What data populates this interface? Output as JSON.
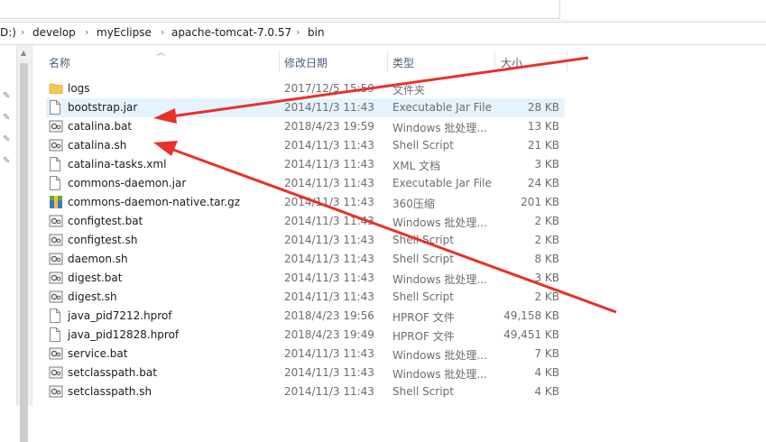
{
  "breadcrumb": [
    "D:)",
    "develop",
    "myEclipse",
    "apache-tomcat-7.0.57",
    "bin"
  ],
  "columns": {
    "name": "名称",
    "date": "修改日期",
    "type": "类型",
    "size": "大小"
  },
  "files": [
    {
      "name": "logs",
      "date": "2017/12/5 15:59",
      "type": "文件夹",
      "size": "",
      "icon": "folder-icon"
    },
    {
      "name": "bootstrap.jar",
      "date": "2014/11/3 11:43",
      "type": "Executable Jar File",
      "size": "28 KB",
      "icon": "file-icon"
    },
    {
      "name": "catalina.bat",
      "date": "2018/4/23 19:59",
      "type": "Windows 批处理...",
      "size": "13 KB",
      "icon": "script-gear-icon"
    },
    {
      "name": "catalina.sh",
      "date": "2014/11/3 11:43",
      "type": "Shell Script",
      "size": "21 KB",
      "icon": "script-gear-icon"
    },
    {
      "name": "catalina-tasks.xml",
      "date": "2014/11/3 11:43",
      "type": "XML 文档",
      "size": "3 KB",
      "icon": "file-icon"
    },
    {
      "name": "commons-daemon.jar",
      "date": "2014/11/3 11:43",
      "type": "Executable Jar File",
      "size": "24 KB",
      "icon": "file-icon"
    },
    {
      "name": "commons-daemon-native.tar.gz",
      "date": "2014/11/3 11:43",
      "type": "360压缩",
      "size": "201 KB",
      "icon": "archive-icon"
    },
    {
      "name": "configtest.bat",
      "date": "2014/11/3 11:43",
      "type": "Windows 批处理...",
      "size": "2 KB",
      "icon": "script-gear-icon"
    },
    {
      "name": "configtest.sh",
      "date": "2014/11/3 11:43",
      "type": "Shell Script",
      "size": "2 KB",
      "icon": "script-gear-icon"
    },
    {
      "name": "daemon.sh",
      "date": "2014/11/3 11:43",
      "type": "Shell Script",
      "size": "8 KB",
      "icon": "script-gear-icon"
    },
    {
      "name": "digest.bat",
      "date": "2014/11/3 11:43",
      "type": "Windows 批处理...",
      "size": "3 KB",
      "icon": "script-gear-icon"
    },
    {
      "name": "digest.sh",
      "date": "2014/11/3 11:43",
      "type": "Shell Script",
      "size": "2 KB",
      "icon": "script-gear-icon"
    },
    {
      "name": "java_pid7212.hprof",
      "date": "2018/4/23 19:56",
      "type": "HPROF 文件",
      "size": "49,158 KB",
      "icon": "file-icon"
    },
    {
      "name": "java_pid12828.hprof",
      "date": "2018/4/23 19:49",
      "type": "HPROF 文件",
      "size": "49,451 KB",
      "icon": "file-icon"
    },
    {
      "name": "service.bat",
      "date": "2014/11/3 11:43",
      "type": "Windows 批处理...",
      "size": "7 KB",
      "icon": "script-gear-icon"
    },
    {
      "name": "setclasspath.bat",
      "date": "2014/11/3 11:43",
      "type": "Windows 批处理...",
      "size": "4 KB",
      "icon": "script-gear-icon"
    },
    {
      "name": "setclasspath.sh",
      "date": "2014/11/3 11:43",
      "type": "Shell Script",
      "size": "4 KB",
      "icon": "script-gear-icon"
    }
  ],
  "colors": {
    "selected": "#e5f3ff",
    "arrow": "#e8312b",
    "header_text": "#4c607a"
  }
}
